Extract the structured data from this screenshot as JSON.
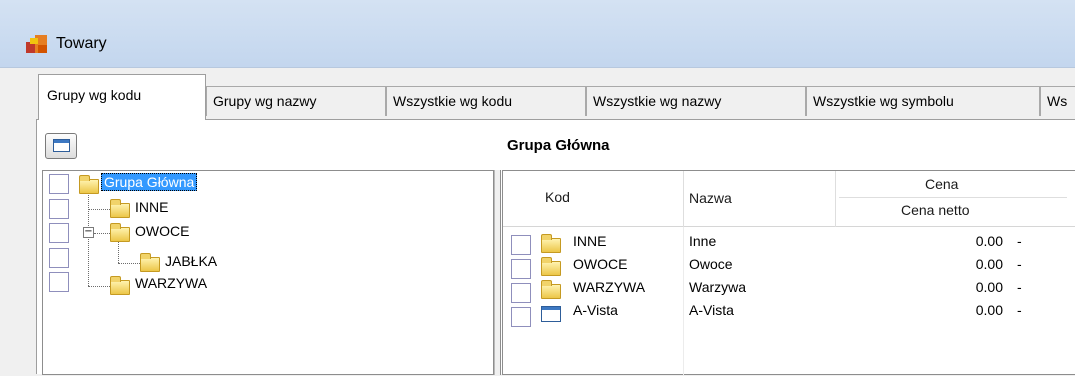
{
  "window": {
    "title": "Towary"
  },
  "tabs": [
    {
      "label": "Grupy wg kodu",
      "active": true
    },
    {
      "label": "Grupy wg nazwy"
    },
    {
      "label": "Wszystkie wg kodu"
    },
    {
      "label": "Wszystkie wg nazwy"
    },
    {
      "label": "Wszystkie wg symbolu"
    },
    {
      "label": "Ws"
    }
  ],
  "tree": {
    "root": {
      "label": "Grupa Główna"
    },
    "children": [
      {
        "label": "INNE"
      },
      {
        "label": "OWOCE",
        "expander": "−"
      },
      {
        "label": "JABŁKA"
      },
      {
        "label": "WARZYWA"
      }
    ]
  },
  "list": {
    "title": "Grupa Główna",
    "headers": {
      "kod": "Kod",
      "nazwa": "Nazwa",
      "cena_group": "Cena",
      "cena_netto": "Cena netto"
    },
    "rows": [
      {
        "kod": "INNE",
        "nazwa": "Inne",
        "cena": "0.00",
        "suffix": "-",
        "icon": "folder-icon"
      },
      {
        "kod": "OWOCE",
        "nazwa": "Owoce",
        "cena": "0.00",
        "suffix": "-",
        "icon": "folder-icon"
      },
      {
        "kod": "WARZYWA",
        "nazwa": "Warzywa",
        "cena": "0.00",
        "suffix": "-",
        "icon": "folder-icon"
      },
      {
        "kod": "A-Vista",
        "nazwa": "A-Vista",
        "cena": "0.00",
        "suffix": "-",
        "icon": "window-icon"
      }
    ]
  },
  "colors": {
    "selection": "#3399ff",
    "titlebar": "#c3d6ee",
    "folder": "#ecc648"
  }
}
